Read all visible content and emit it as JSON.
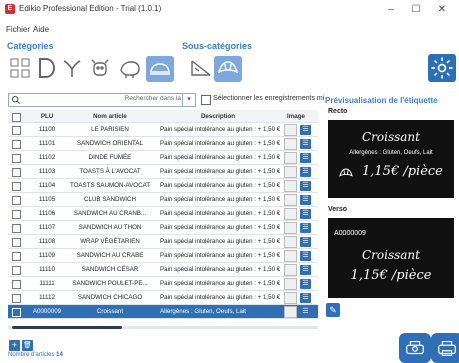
{
  "window": {
    "title": "Edikio Professional Edition - Trial (1.0.1)",
    "icon_letter": "E",
    "minimize": "–",
    "maximize": "☐",
    "close": "✕"
  },
  "menu": {
    "items": [
      "Fichier",
      "Aide"
    ]
  },
  "categories": {
    "title": "Catégories",
    "subtitle": "Sous-catégories"
  },
  "search": {
    "placeholder": "Rechercher dans la",
    "dropdown_glyph": "▾",
    "select_all_label": "Sélectionner les enregistrements mi"
  },
  "table": {
    "headers": [
      "PLU",
      "Nom article",
      "Description",
      "Image"
    ],
    "rows": [
      {
        "plu": "11100",
        "nom": "LE PARISIEN",
        "desc": "Pain spécial intolérance au gluten : + 1,50 €"
      },
      {
        "plu": "11101",
        "nom": "SANDWICH ORIENTAL",
        "desc": "Pain spécial intolérance au gluten : + 1,50 €"
      },
      {
        "plu": "11102",
        "nom": "DINDE FUMÉE",
        "desc": "Pain spécial intolérance au gluten : + 1,50 €"
      },
      {
        "plu": "11103",
        "nom": "TOASTS À L'AVOCAT",
        "desc": "Pain spécial intolérance au gluten : + 1,50 €"
      },
      {
        "plu": "11104",
        "nom": "TOASTS SAUMON-AVOCAT",
        "desc": "Pain spécial intolérance au gluten : + 1,50 €"
      },
      {
        "plu": "11105",
        "nom": "CLUB SANDWICH",
        "desc": "Pain spécial intolérance au gluten : + 1,50 €"
      },
      {
        "plu": "11106",
        "nom": "SANDWICH AU CRANB...",
        "desc": "Pain spécial intolérance au gluten : + 1,50 €"
      },
      {
        "plu": "11107",
        "nom": "SANDWICH AU THON",
        "desc": "Pain spécial intolérance au gluten : + 1,50 €"
      },
      {
        "plu": "11108",
        "nom": "WRAP VÉGÉTARIEN",
        "desc": "Pain spécial intolérance au gluten : + 1,50 €"
      },
      {
        "plu": "11109",
        "nom": "SANDWICH AU CRABE",
        "desc": "Pain spécial intolérance au gluten : + 1,50 €"
      },
      {
        "plu": "11110",
        "nom": "SANDWICH CÉSAR",
        "desc": "Pain spécial intolérance au gluten : + 1,50 €"
      },
      {
        "plu": "11111",
        "nom": "SANDWICH POULET-PE...",
        "desc": "Pain spécial intolérance au gluten : + 1,50 €"
      },
      {
        "plu": "11112",
        "nom": "SANDWICH CHICAGO",
        "desc": "Pain spécial intolérance au gluten : + 1,50 €"
      },
      {
        "plu": "A0000009",
        "nom": "Croissant",
        "desc": "Allergènes : Gluten, Oeufs, Lait",
        "selected": true
      }
    ]
  },
  "footer": {
    "add_glyph": "+",
    "delete_glyph": "🗑",
    "count_label": "Nombre d'articles",
    "count_value": "14"
  },
  "preview": {
    "title": "Prévisualisation de l'étiquette",
    "recto_label": "Recto",
    "verso_label": "Verso",
    "recto": {
      "name": "Croissant",
      "allergens": "Allergènes : Gluten, Oeufs, Lait",
      "price": "1,15€ /pièce"
    },
    "verso": {
      "code": "A0000009",
      "name": "Croissant",
      "price": "1,15€ /pièce"
    },
    "edit_glyph": "✎"
  },
  "colors": {
    "accent": "#2f6fb3",
    "selected_row": "#2f6fb3",
    "section_title": "#3b7fd4"
  }
}
